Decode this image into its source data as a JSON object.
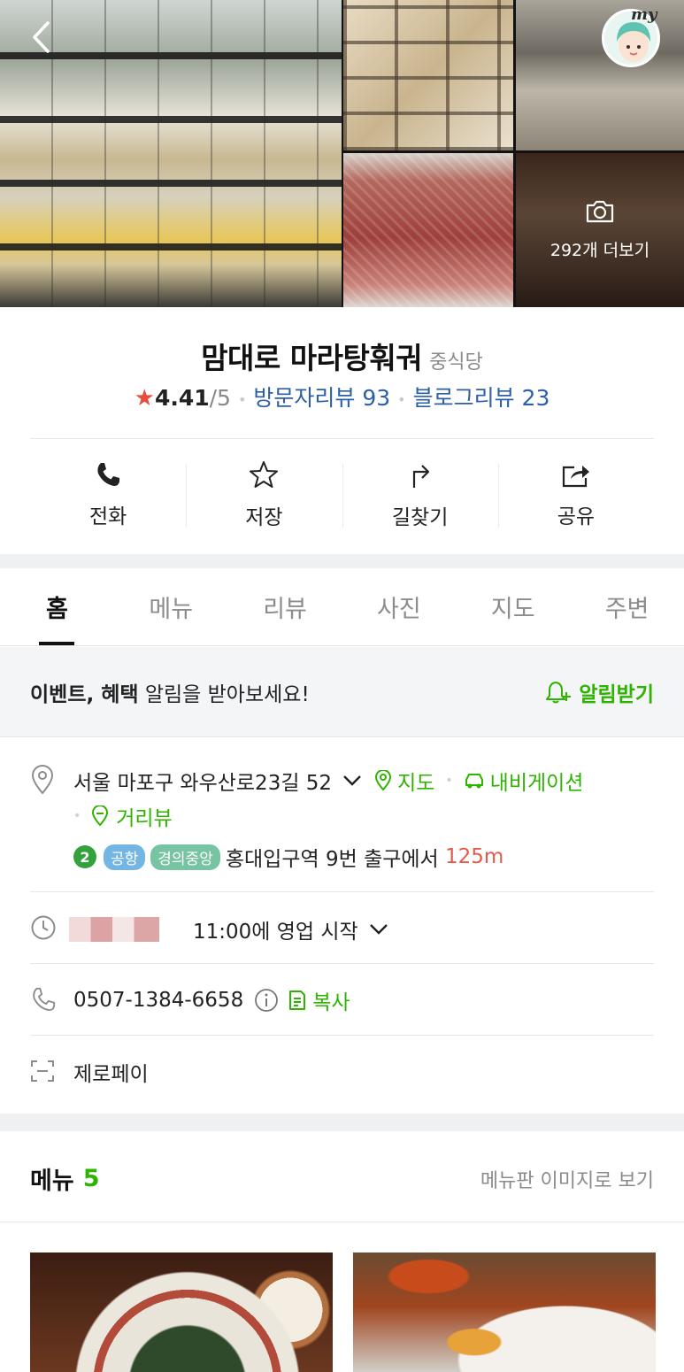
{
  "gallery": {
    "more_label": "292개 더보기",
    "my_label": "my"
  },
  "place": {
    "name": "맘대로 마라탕훠궈",
    "category": "중식당",
    "rating": "4.41",
    "rating_max": "/5",
    "visitor_reviews": "방문자리뷰 93",
    "blog_reviews": "블로그리뷰 23"
  },
  "actions": [
    {
      "label": "전화",
      "icon": "phone-icon"
    },
    {
      "label": "저장",
      "icon": "star-outline-icon"
    },
    {
      "label": "길찾기",
      "icon": "directions-icon"
    },
    {
      "label": "공유",
      "icon": "share-icon"
    }
  ],
  "tabs": [
    "홈",
    "메뉴",
    "리뷰",
    "사진",
    "지도",
    "주변"
  ],
  "active_tab": "홈",
  "event": {
    "bold_part": "이벤트, 혜택",
    "rest": " 알림을 받아보세요!",
    "button": "알림받기"
  },
  "info": {
    "address": "서울 마포구 와우산로23길 52",
    "map_link": "지도",
    "navi_link": "내비게이션",
    "street_view": "거리뷰",
    "subway": {
      "line_number": "2",
      "pill_airport": "공항",
      "pill_gj": "경의중앙",
      "station": "홍대입구역",
      "exit_text": " 9번 출구에서 ",
      "distance": "125m"
    },
    "hours": "11:00에 영업 시작",
    "phone": "0507-1384-6658",
    "copy_label": "복사",
    "zeropay": "제로페이"
  },
  "menu": {
    "title": "메뉴",
    "count": "5",
    "image_link": "메뉴판 이미지로 보기"
  },
  "colors": {
    "accent_green": "#2db400",
    "link_blue": "#2c5fa8",
    "star_red": "#e94d3c",
    "distance_red": "#e65a4b"
  }
}
